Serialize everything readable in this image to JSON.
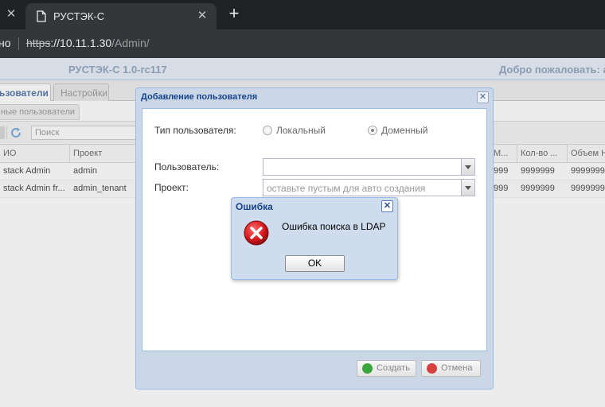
{
  "browser": {
    "prev_tab_close": "✕",
    "tab_title": "РУСТЭК-С",
    "tab_close": "✕",
    "new_tab": "+",
    "security_label": "но",
    "url_scheme": "https",
    "url_host": "://10.11.1.30",
    "url_path": "/Admin/"
  },
  "app": {
    "title": "РУСТЭК-С 1.0-rc117",
    "welcome": "Добро пожаловать: a"
  },
  "main_tabs": [
    {
      "label": "ьзователи",
      "active": true
    },
    {
      "label": "Настройки",
      "active": false
    }
  ],
  "sub_tab": "ные пользователи",
  "toolbar": {
    "search_placeholder": "Поиск"
  },
  "grid": {
    "columns": [
      "ИО",
      "Проект",
      "М...",
      "Кол-во ...",
      "Объем Н"
    ],
    "rows": [
      [
        "stack Admin",
        "admin",
        "999",
        "9999999",
        "9999999"
      ],
      [
        "stack Admin fr...",
        "admin_tenant",
        "999",
        "9999999",
        "9999999"
      ]
    ]
  },
  "add_user_window": {
    "title": "Добавление пользователя",
    "close": "✕",
    "user_type_label": "Тип пользователя:",
    "radio_local": "Локальный",
    "radio_domain": "Доменный",
    "selected_type": "Доменный",
    "user_label": "Пользователь:",
    "user_value": "",
    "project_label": "Проект:",
    "project_placeholder": "оставьте пустым для авто создания",
    "create_button": "Создать",
    "cancel_button": "Отмена"
  },
  "error_dialog": {
    "title": "Ошибка",
    "close": "✕",
    "message": "Ошибка поиска в LDAP",
    "ok_button": "OK"
  },
  "colors": {
    "accent": "#15428b",
    "header_text": "#6a84a6",
    "error_red": "#d0161b",
    "create_green": "#3aa53a"
  }
}
